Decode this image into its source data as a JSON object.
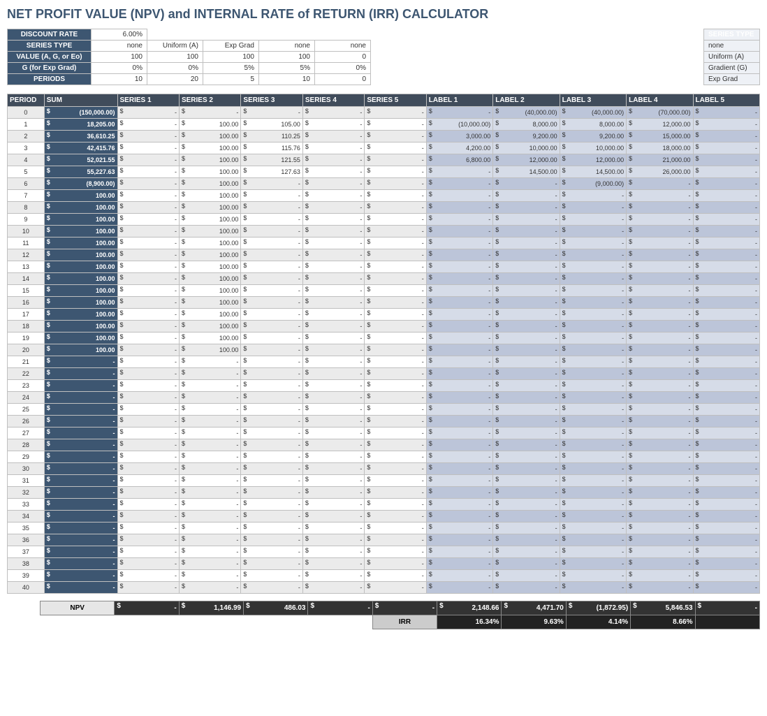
{
  "title": "NET PROFIT VALUE (NPV) and INTERNAL RATE of RETURN (IRR) CALCULATOR",
  "params": {
    "rows": [
      {
        "label": "DISCOUNT RATE",
        "vals": [
          "6.00%",
          "",
          "",
          "",
          ""
        ]
      },
      {
        "label": "SERIES TYPE",
        "vals": [
          "none",
          "Uniform (A)",
          "Exp Grad",
          "none",
          "none"
        ]
      },
      {
        "label": "VALUE (A, G, or Eo)",
        "vals": [
          "100",
          "100",
          "100",
          "100",
          "0"
        ]
      },
      {
        "label": "G (for Exp Grad)",
        "vals": [
          "0%",
          "0%",
          "5%",
          "5%",
          "0%"
        ]
      },
      {
        "label": "PERIODS",
        "vals": [
          "10",
          "20",
          "5",
          "10",
          "0"
        ]
      }
    ]
  },
  "legend": {
    "header": "SERIES TYPE",
    "items": [
      "none",
      "Uniform (A)",
      "Gradient (G)",
      "Exp Grad"
    ]
  },
  "mainHeaders": [
    "PERIOD",
    "SUM",
    "SERIES 1",
    "SERIES 2",
    "SERIES 3",
    "SERIES 4",
    "SERIES 5",
    "LABEL 1",
    "LABEL 2",
    "LABEL 3",
    "LABEL 4",
    "LABEL 5"
  ],
  "rows": [
    {
      "p": "0",
      "sum": "(150,000.00)",
      "s": [
        "-",
        "-",
        "-",
        "-",
        "-"
      ],
      "l": [
        "-",
        "(40,000.00)",
        "(40,000.00)",
        "(70,000.00)",
        "-"
      ]
    },
    {
      "p": "1",
      "sum": "18,205.00",
      "s": [
        "-",
        "100.00",
        "105.00",
        "-",
        "-"
      ],
      "l": [
        "(10,000.00)",
        "8,000.00",
        "8,000.00",
        "12,000.00",
        "-"
      ]
    },
    {
      "p": "2",
      "sum": "36,610.25",
      "s": [
        "-",
        "100.00",
        "110.25",
        "-",
        "-"
      ],
      "l": [
        "3,000.00",
        "9,200.00",
        "9,200.00",
        "15,000.00",
        "-"
      ]
    },
    {
      "p": "3",
      "sum": "42,415.76",
      "s": [
        "-",
        "100.00",
        "115.76",
        "-",
        "-"
      ],
      "l": [
        "4,200.00",
        "10,000.00",
        "10,000.00",
        "18,000.00",
        "-"
      ]
    },
    {
      "p": "4",
      "sum": "52,021.55",
      "s": [
        "-",
        "100.00",
        "121.55",
        "-",
        "-"
      ],
      "l": [
        "6,800.00",
        "12,000.00",
        "12,000.00",
        "21,000.00",
        "-"
      ]
    },
    {
      "p": "5",
      "sum": "55,227.63",
      "s": [
        "-",
        "100.00",
        "127.63",
        "-",
        "-"
      ],
      "l": [
        "-",
        "14,500.00",
        "14,500.00",
        "26,000.00",
        "-"
      ]
    },
    {
      "p": "6",
      "sum": "(8,900.00)",
      "s": [
        "-",
        "100.00",
        "-",
        "-",
        "-"
      ],
      "l": [
        "-",
        "-",
        "(9,000.00)",
        "-",
        "-"
      ]
    },
    {
      "p": "7",
      "sum": "100.00",
      "s": [
        "-",
        "100.00",
        "-",
        "-",
        "-"
      ],
      "l": [
        "-",
        "-",
        "-",
        "-",
        "-"
      ]
    },
    {
      "p": "8",
      "sum": "100.00",
      "s": [
        "-",
        "100.00",
        "-",
        "-",
        "-"
      ],
      "l": [
        "-",
        "-",
        "-",
        "-",
        "-"
      ]
    },
    {
      "p": "9",
      "sum": "100.00",
      "s": [
        "-",
        "100.00",
        "-",
        "-",
        "-"
      ],
      "l": [
        "-",
        "-",
        "-",
        "-",
        "-"
      ]
    },
    {
      "p": "10",
      "sum": "100.00",
      "s": [
        "-",
        "100.00",
        "-",
        "-",
        "-"
      ],
      "l": [
        "-",
        "-",
        "-",
        "-",
        "-"
      ]
    },
    {
      "p": "11",
      "sum": "100.00",
      "s": [
        "-",
        "100.00",
        "-",
        "-",
        "-"
      ],
      "l": [
        "-",
        "-",
        "-",
        "-",
        "-"
      ]
    },
    {
      "p": "12",
      "sum": "100.00",
      "s": [
        "-",
        "100.00",
        "-",
        "-",
        "-"
      ],
      "l": [
        "-",
        "-",
        "-",
        "-",
        "-"
      ]
    },
    {
      "p": "13",
      "sum": "100.00",
      "s": [
        "-",
        "100.00",
        "-",
        "-",
        "-"
      ],
      "l": [
        "-",
        "-",
        "-",
        "-",
        "-"
      ]
    },
    {
      "p": "14",
      "sum": "100.00",
      "s": [
        "-",
        "100.00",
        "-",
        "-",
        "-"
      ],
      "l": [
        "-",
        "-",
        "-",
        "-",
        "-"
      ]
    },
    {
      "p": "15",
      "sum": "100.00",
      "s": [
        "-",
        "100.00",
        "-",
        "-",
        "-"
      ],
      "l": [
        "-",
        "-",
        "-",
        "-",
        "-"
      ]
    },
    {
      "p": "16",
      "sum": "100.00",
      "s": [
        "-",
        "100.00",
        "-",
        "-",
        "-"
      ],
      "l": [
        "-",
        "-",
        "-",
        "-",
        "-"
      ]
    },
    {
      "p": "17",
      "sum": "100.00",
      "s": [
        "-",
        "100.00",
        "-",
        "-",
        "-"
      ],
      "l": [
        "-",
        "-",
        "-",
        "-",
        "-"
      ]
    },
    {
      "p": "18",
      "sum": "100.00",
      "s": [
        "-",
        "100.00",
        "-",
        "-",
        "-"
      ],
      "l": [
        "-",
        "-",
        "-",
        "-",
        "-"
      ]
    },
    {
      "p": "19",
      "sum": "100.00",
      "s": [
        "-",
        "100.00",
        "-",
        "-",
        "-"
      ],
      "l": [
        "-",
        "-",
        "-",
        "-",
        "-"
      ]
    },
    {
      "p": "20",
      "sum": "100.00",
      "s": [
        "-",
        "100.00",
        "-",
        "-",
        "-"
      ],
      "l": [
        "-",
        "-",
        "-",
        "-",
        "-"
      ]
    },
    {
      "p": "21",
      "sum": "-",
      "s": [
        "-",
        "-",
        "-",
        "-",
        "-"
      ],
      "l": [
        "-",
        "-",
        "-",
        "-",
        "-"
      ]
    },
    {
      "p": "22",
      "sum": "-",
      "s": [
        "-",
        "-",
        "-",
        "-",
        "-"
      ],
      "l": [
        "-",
        "-",
        "-",
        "-",
        "-"
      ]
    },
    {
      "p": "23",
      "sum": "-",
      "s": [
        "-",
        "-",
        "-",
        "-",
        "-"
      ],
      "l": [
        "-",
        "-",
        "-",
        "-",
        "-"
      ]
    },
    {
      "p": "24",
      "sum": "-",
      "s": [
        "-",
        "-",
        "-",
        "-",
        "-"
      ],
      "l": [
        "-",
        "-",
        "-",
        "-",
        "-"
      ]
    },
    {
      "p": "25",
      "sum": "-",
      "s": [
        "-",
        "-",
        "-",
        "-",
        "-"
      ],
      "l": [
        "-",
        "-",
        "-",
        "-",
        "-"
      ]
    },
    {
      "p": "26",
      "sum": "-",
      "s": [
        "-",
        "-",
        "-",
        "-",
        "-"
      ],
      "l": [
        "-",
        "-",
        "-",
        "-",
        "-"
      ]
    },
    {
      "p": "27",
      "sum": "-",
      "s": [
        "-",
        "-",
        "-",
        "-",
        "-"
      ],
      "l": [
        "-",
        "-",
        "-",
        "-",
        "-"
      ]
    },
    {
      "p": "28",
      "sum": "-",
      "s": [
        "-",
        "-",
        "-",
        "-",
        "-"
      ],
      "l": [
        "-",
        "-",
        "-",
        "-",
        "-"
      ]
    },
    {
      "p": "29",
      "sum": "-",
      "s": [
        "-",
        "-",
        "-",
        "-",
        "-"
      ],
      "l": [
        "-",
        "-",
        "-",
        "-",
        "-"
      ]
    },
    {
      "p": "30",
      "sum": "-",
      "s": [
        "-",
        "-",
        "-",
        "-",
        "-"
      ],
      "l": [
        "-",
        "-",
        "-",
        "-",
        "-"
      ]
    },
    {
      "p": "31",
      "sum": "-",
      "s": [
        "-",
        "-",
        "-",
        "-",
        "-"
      ],
      "l": [
        "-",
        "-",
        "-",
        "-",
        "-"
      ]
    },
    {
      "p": "32",
      "sum": "-",
      "s": [
        "-",
        "-",
        "-",
        "-",
        "-"
      ],
      "l": [
        "-",
        "-",
        "-",
        "-",
        "-"
      ]
    },
    {
      "p": "33",
      "sum": "-",
      "s": [
        "-",
        "-",
        "-",
        "-",
        "-"
      ],
      "l": [
        "-",
        "-",
        "-",
        "-",
        "-"
      ]
    },
    {
      "p": "34",
      "sum": "-",
      "s": [
        "-",
        "-",
        "-",
        "-",
        "-"
      ],
      "l": [
        "-",
        "-",
        "-",
        "-",
        "-"
      ]
    },
    {
      "p": "35",
      "sum": "-",
      "s": [
        "-",
        "-",
        "-",
        "-",
        "-"
      ],
      "l": [
        "-",
        "-",
        "-",
        "-",
        "-"
      ]
    },
    {
      "p": "36",
      "sum": "-",
      "s": [
        "-",
        "-",
        "-",
        "-",
        "-"
      ],
      "l": [
        "-",
        "-",
        "-",
        "-",
        "-"
      ]
    },
    {
      "p": "37",
      "sum": "-",
      "s": [
        "-",
        "-",
        "-",
        "-",
        "-"
      ],
      "l": [
        "-",
        "-",
        "-",
        "-",
        "-"
      ]
    },
    {
      "p": "38",
      "sum": "-",
      "s": [
        "-",
        "-",
        "-",
        "-",
        "-"
      ],
      "l": [
        "-",
        "-",
        "-",
        "-",
        "-"
      ]
    },
    {
      "p": "39",
      "sum": "-",
      "s": [
        "-",
        "-",
        "-",
        "-",
        "-"
      ],
      "l": [
        "-",
        "-",
        "-",
        "-",
        "-"
      ]
    },
    {
      "p": "40",
      "sum": "-",
      "s": [
        "-",
        "-",
        "-",
        "-",
        "-"
      ],
      "l": [
        "-",
        "-",
        "-",
        "-",
        "-"
      ]
    }
  ],
  "npv": {
    "label": "NPV",
    "vals": [
      "-",
      "1,146.99",
      "486.03",
      "-",
      "-",
      "2,148.66",
      "4,471.70",
      "(1,872.95)",
      "5,846.53",
      "-"
    ]
  },
  "irr": {
    "label": "IRR",
    "vals": [
      "16.34%",
      "9.63%",
      "4.14%",
      "8.66%",
      ""
    ]
  }
}
